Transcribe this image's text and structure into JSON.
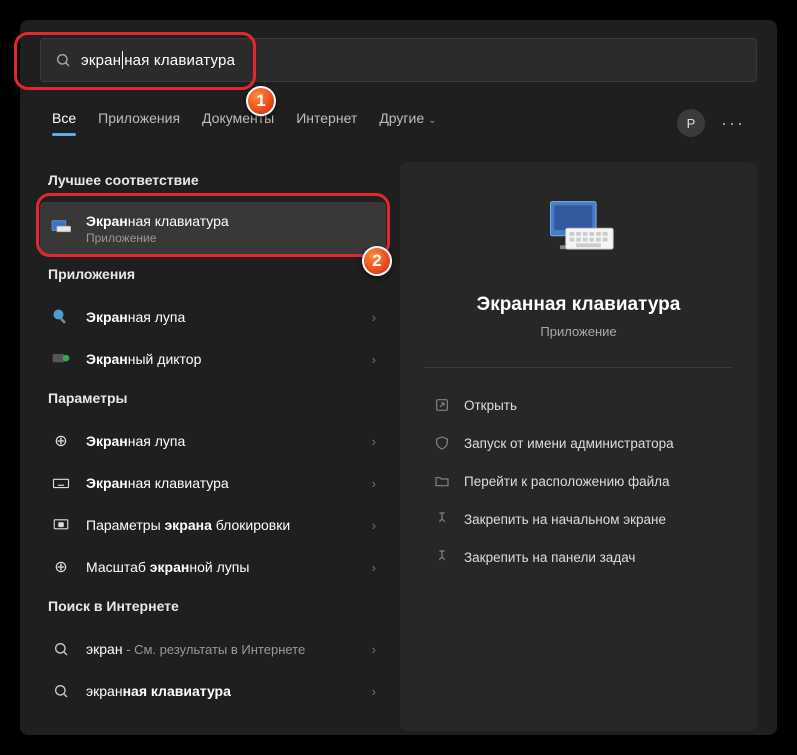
{
  "search": {
    "prefix": "экран",
    "suffix": "ная клавиатура"
  },
  "tabs": [
    "Все",
    "Приложения",
    "Документы",
    "Интернет",
    "Другие"
  ],
  "avatar": "P",
  "sections": {
    "best": "Лучшее соответствие",
    "apps": "Приложения",
    "params": "Параметры",
    "web": "Поиск в Интернете"
  },
  "bestItem": {
    "hl": "Экран",
    "rest": "ная клавиатура",
    "sub": "Приложение"
  },
  "apps": [
    {
      "hl": "Экран",
      "rest": "ная лупа"
    },
    {
      "hl": "Экран",
      "rest": "ный диктор"
    }
  ],
  "params": [
    {
      "hl": "Экран",
      "rest": "ная лупа"
    },
    {
      "hl": "Экран",
      "rest": "ная клавиатура"
    },
    {
      "pre": "Параметры ",
      "hl": "экрана",
      "rest": " блокировки"
    },
    {
      "pre": "Масштаб ",
      "hl": "экран",
      "rest": "ной лупы"
    }
  ],
  "web": [
    {
      "q": "экран",
      "tail": " - См. результаты в Интернете"
    },
    {
      "pre": "экран",
      "hl": "ная клавиатура",
      "rest": ""
    }
  ],
  "preview": {
    "title": "Экранная клавиатура",
    "sub": "Приложение"
  },
  "actions": [
    "Открыть",
    "Запуск от имени администратора",
    "Перейти к расположению файла",
    "Закрепить на начальном экране",
    "Закрепить на панели задач"
  ],
  "badges": {
    "b1": "1",
    "b2": "2"
  }
}
